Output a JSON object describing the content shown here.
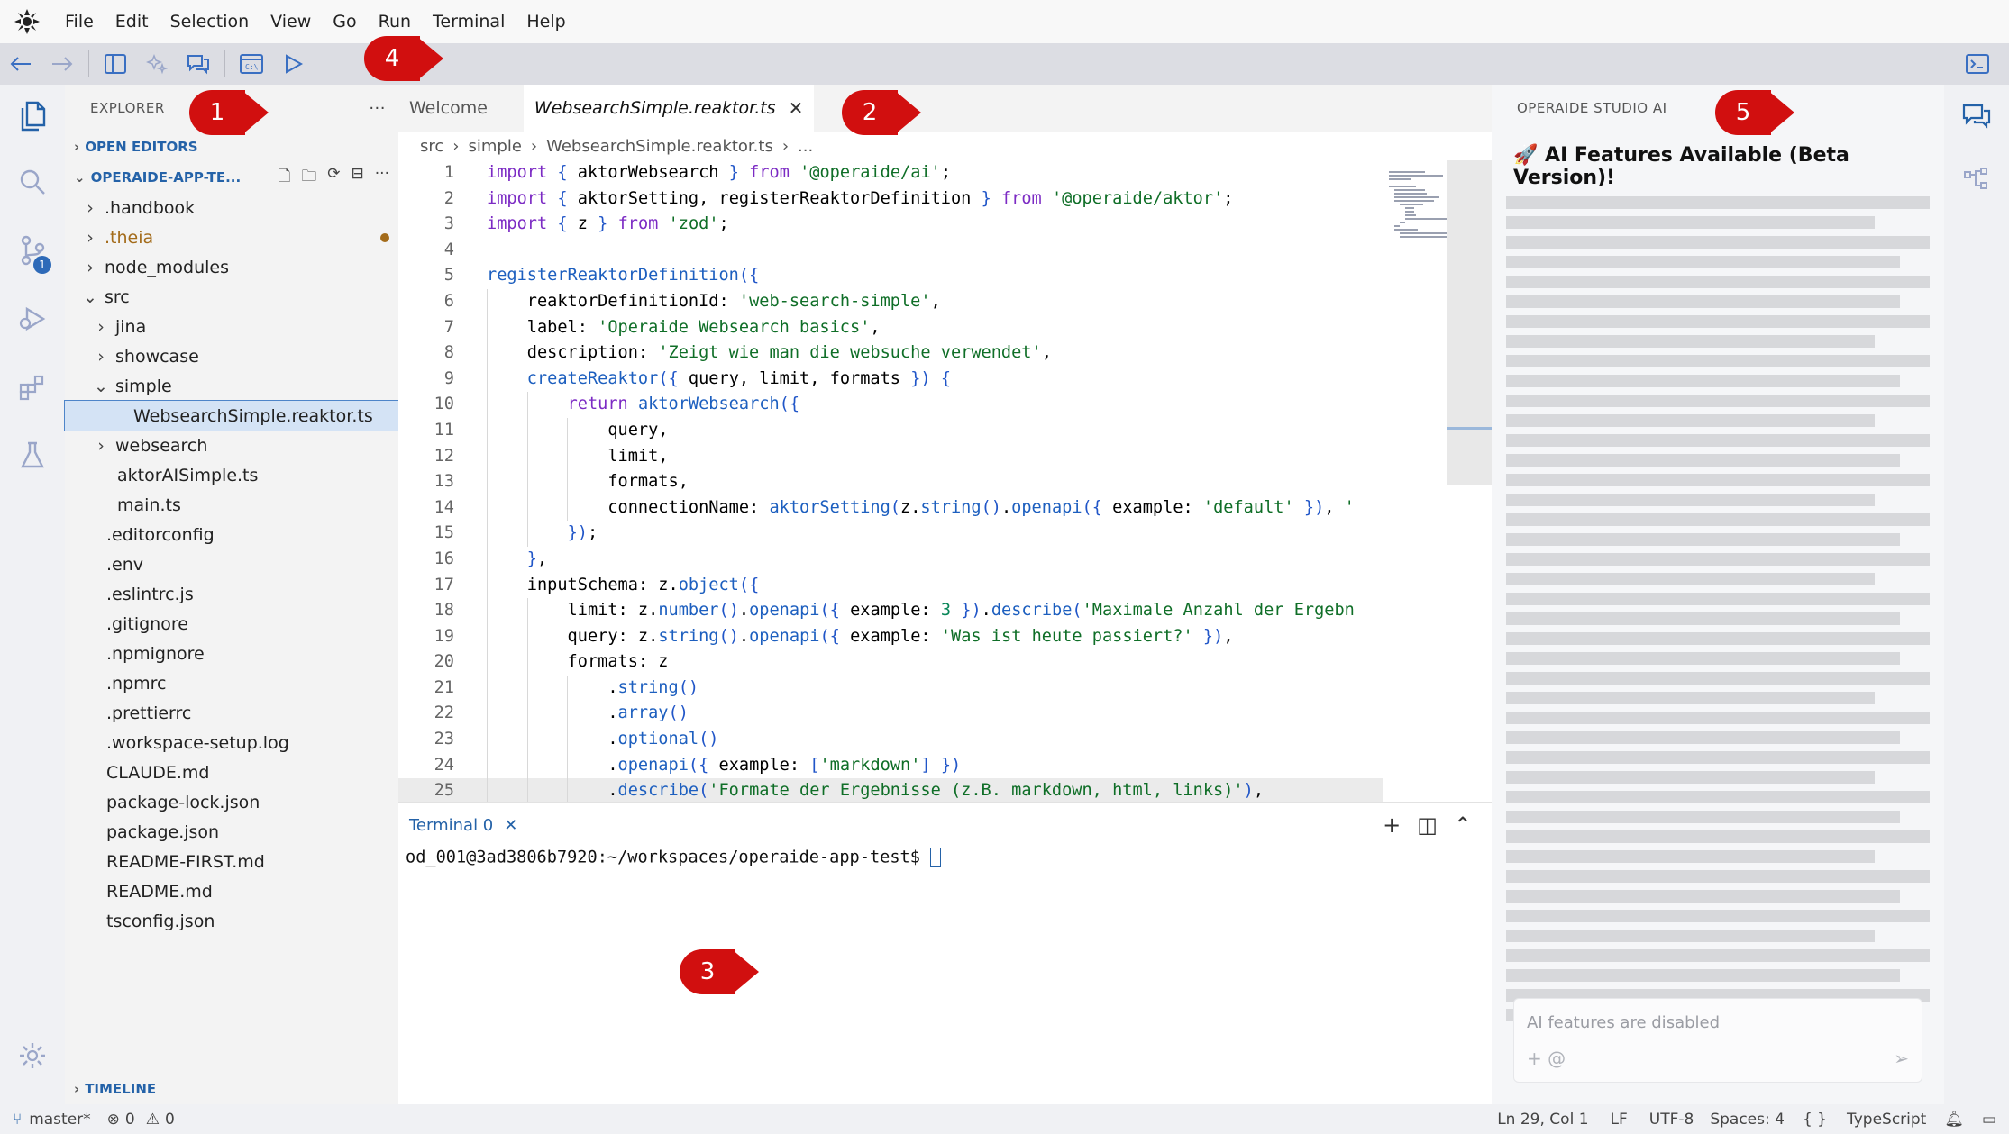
{
  "menu": [
    "File",
    "Edit",
    "Selection",
    "View",
    "Go",
    "Run",
    "Terminal",
    "Help"
  ],
  "annotations": {
    "one": "1",
    "two": "2",
    "three": "3",
    "four": "4",
    "five": "5"
  },
  "explorer": {
    "title": "EXPLORER",
    "open_editors": "OPEN EDITORS",
    "workspace": "OPERAIDE-APP-TE...",
    "more": "···",
    "timeline": "TIMELINE",
    "tree": [
      {
        "label": ".handbook",
        "indent": 0,
        "chev": ">"
      },
      {
        "label": ".theia",
        "indent": 0,
        "chev": ">",
        "modified": true
      },
      {
        "label": "node_modules",
        "indent": 0,
        "chev": ">"
      },
      {
        "label": "src",
        "indent": 0,
        "chev": "v"
      },
      {
        "label": "jina",
        "indent": 1,
        "chev": ">"
      },
      {
        "label": "showcase",
        "indent": 1,
        "chev": ">"
      },
      {
        "label": "simple",
        "indent": 1,
        "chev": "v"
      },
      {
        "label": "WebsearchSimple.reaktor.ts",
        "indent": 2,
        "chev": "",
        "selected": true
      },
      {
        "label": "websearch",
        "indent": 1,
        "chev": ">"
      },
      {
        "label": "aktorAISimple.ts",
        "indent": 1,
        "chev": ""
      },
      {
        "label": "main.ts",
        "indent": 1,
        "chev": ""
      },
      {
        "label": ".editorconfig",
        "indent": 0,
        "chev": ""
      },
      {
        "label": ".env",
        "indent": 0,
        "chev": ""
      },
      {
        "label": ".eslintrc.js",
        "indent": 0,
        "chev": ""
      },
      {
        "label": ".gitignore",
        "indent": 0,
        "chev": ""
      },
      {
        "label": ".npmignore",
        "indent": 0,
        "chev": ""
      },
      {
        "label": ".npmrc",
        "indent": 0,
        "chev": ""
      },
      {
        "label": ".prettierrc",
        "indent": 0,
        "chev": ""
      },
      {
        "label": ".workspace-setup.log",
        "indent": 0,
        "chev": ""
      },
      {
        "label": "CLAUDE.md",
        "indent": 0,
        "chev": ""
      },
      {
        "label": "package-lock.json",
        "indent": 0,
        "chev": ""
      },
      {
        "label": "package.json",
        "indent": 0,
        "chev": ""
      },
      {
        "label": "README-FIRST.md",
        "indent": 0,
        "chev": ""
      },
      {
        "label": "README.md",
        "indent": 0,
        "chev": ""
      },
      {
        "label": "tsconfig.json",
        "indent": 0,
        "chev": ""
      }
    ]
  },
  "activity": {
    "scm_badge": "1"
  },
  "editor": {
    "tabs": [
      {
        "label": "Welcome",
        "active": false
      },
      {
        "label": "WebsearchSimple.reaktor.ts",
        "active": true
      }
    ],
    "breadcrumb": [
      "src",
      "simple",
      "WebsearchSimple.reaktor.ts",
      "..."
    ],
    "lines": [
      "import { aktorWebsearch } from '@operaide/ai';",
      "import { aktorSetting, registerReaktorDefinition } from '@operaide/aktor';",
      "import { z } from 'zod';",
      "",
      "registerReaktorDefinition({",
      "    reaktorDefinitionId: 'web-search-simple',",
      "    label: 'Operaide Websearch basics',",
      "    description: 'Zeigt wie man die websuche verwendet',",
      "    createReaktor({ query, limit, formats }) {",
      "        return aktorWebsearch({",
      "            query,",
      "            limit,",
      "            formats,",
      "            connectionName: aktorSetting(z.string().openapi({ example: 'default' }), '",
      "        });",
      "    },",
      "    inputSchema: z.object({",
      "        limit: z.number().openapi({ example: 3 }).describe('Maximale Anzahl der Ergebn",
      "        query: z.string().openapi({ example: 'Was ist heute passiert?' }),",
      "        formats: z",
      "            .string()",
      "            .array()",
      "            .optional()",
      "            .openapi({ example: ['markdown'] })",
      "            .describe('Formate der Ergebnisse (z.B. markdown, html, links)'),"
    ]
  },
  "terminal": {
    "tab": "Terminal 0",
    "prompt": "od_001@3ad3806b7920:~/workspaces/operaide-app-test$ "
  },
  "ai": {
    "title": "OPERAIDE STUDIO AI",
    "heading": "🚀 AI Features Available (Beta Version)!",
    "input_placeholder": "AI features are disabled",
    "input_icons": "+ @"
  },
  "status": {
    "branch": "master*",
    "errors": "0",
    "warnings": "0",
    "position": "Ln 29, Col 1",
    "eol": "LF",
    "encoding": "UTF-8",
    "spaces": "Spaces: 4",
    "braces": "{ }",
    "language": "TypeScript"
  }
}
